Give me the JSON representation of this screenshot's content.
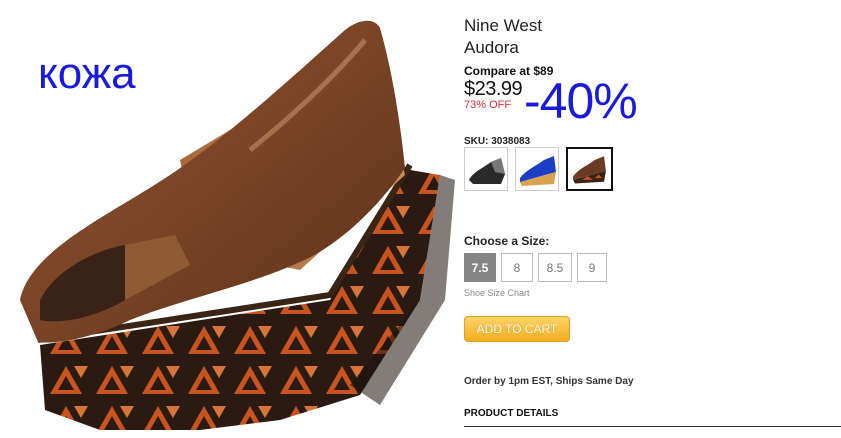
{
  "product": {
    "brand": "Nine West",
    "model": "Audora",
    "compare_at": "Compare at $89",
    "price": "$23.99",
    "discount": "73% OFF",
    "sku": "SKU: 3038083",
    "image_icon": "wedge-peep-toe-shoe"
  },
  "overlays": {
    "leather": "кожа",
    "discount": "-40%",
    "color": "#1a1adb"
  },
  "swatches": [
    {
      "name": "black",
      "color": "#2a2a2a",
      "selected": false
    },
    {
      "name": "blue",
      "color": "#1a3fc4",
      "selected": false
    },
    {
      "name": "brown",
      "color": "#6b3a22",
      "selected": true
    }
  ],
  "sizes": {
    "label": "Choose a Size:",
    "options": [
      "7.5",
      "8",
      "8.5",
      "9"
    ],
    "selected": "7.5",
    "chart_link": "Shoe Size Chart"
  },
  "cart": {
    "button_label": "ADD TO CART",
    "accent": "#f2ad1f"
  },
  "shipping": {
    "note": "Order by 1pm EST, Ships Same Day"
  },
  "details": {
    "tab_label": "PRODUCT DETAILS"
  }
}
